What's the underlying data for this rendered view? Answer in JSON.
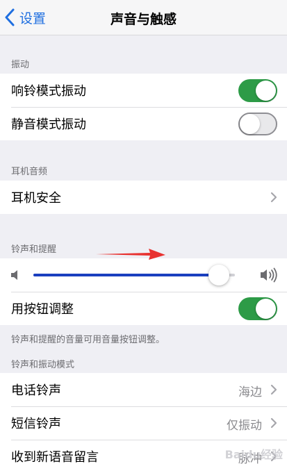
{
  "nav": {
    "back_label": "设置",
    "title": "声音与触感"
  },
  "vibration": {
    "header": "振动",
    "ring_label": "响铃模式振动",
    "ring_on": true,
    "silent_label": "静音模式振动",
    "silent_on": false
  },
  "headphone": {
    "header": "耳机音频",
    "safety_label": "耳机安全"
  },
  "ringer": {
    "header": "铃声和提醒",
    "volume_level": 0.92,
    "button_adjust_label": "用按钮调整",
    "button_adjust_on": true,
    "footer": "铃声和提醒的音量可用音量按钮调整。"
  },
  "patterns": {
    "header": "铃声和振动模式",
    "items": [
      {
        "label": "电话铃声",
        "value": "海边"
      },
      {
        "label": "短信铃声",
        "value": "仅振动"
      },
      {
        "label": "收到新语音留言",
        "value": "脉冲"
      }
    ]
  },
  "watermark": "Baidu经验",
  "colors": {
    "toggle_on": "#2d9b47",
    "slider_fill": "#1a3fbf",
    "link": "#1f6fe0",
    "annotation_arrow": "#e8312f"
  }
}
